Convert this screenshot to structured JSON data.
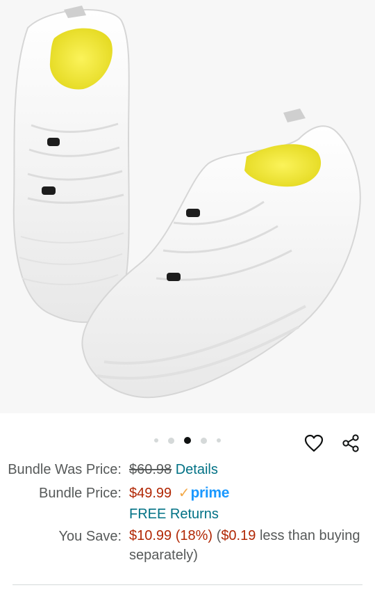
{
  "product_image": {
    "icon": "barefoot-shoes-image"
  },
  "carousel": {
    "dot_count": 5,
    "active_index": 2
  },
  "actions": {
    "favorite_icon": "heart-icon",
    "share_icon": "share-icon"
  },
  "pricing": {
    "bundle_was_label": "Bundle Was Price:",
    "bundle_was_value": "$60.98",
    "details_link": "Details",
    "bundle_price_label": "Bundle Price:",
    "bundle_price_value": "$49.99",
    "prime_check": "✓",
    "prime_word": "prime",
    "free_returns": "FREE Returns",
    "you_save_label": "You Save:",
    "you_save_value": "$10.99 (18%)",
    "separate_open": "(",
    "separate_amount": "$0.19",
    "separate_text": "less than buying separately)"
  },
  "colors": {
    "price_red": "#B12704",
    "link_teal": "#007185",
    "prime_blue": "#1A98FF",
    "prime_orange": "#F3A847"
  }
}
